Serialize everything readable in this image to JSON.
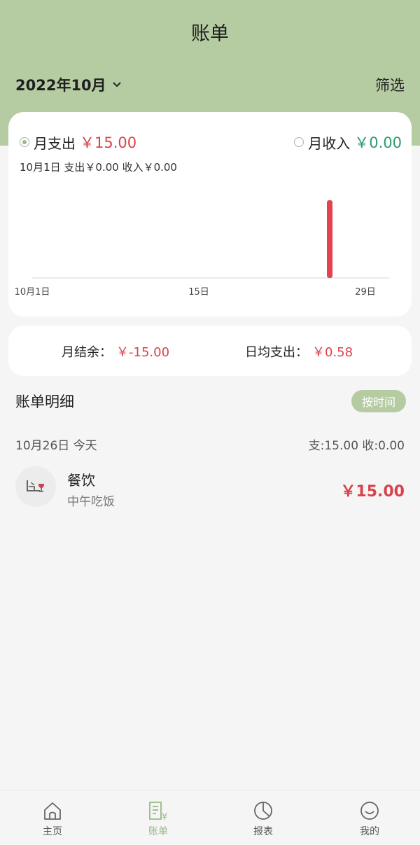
{
  "header": {
    "title": "账单",
    "month": "2022年10月",
    "filter_label": "筛选"
  },
  "chart_card": {
    "expense_label": "月支出",
    "expense_amount": "￥15.00",
    "income_label": "月收入",
    "income_amount": "￥0.00",
    "selected": "expense",
    "day_info": "10月1日  支出￥0.00  收入￥0.00"
  },
  "chart_data": {
    "type": "bar",
    "x_tick_labels": [
      "10月1日",
      "15日",
      "29日"
    ],
    "x": [
      1,
      2,
      3,
      4,
      5,
      6,
      7,
      8,
      9,
      10,
      11,
      12,
      13,
      14,
      15,
      16,
      17,
      18,
      19,
      20,
      21,
      22,
      23,
      24,
      25,
      26,
      27,
      28,
      29,
      30,
      31
    ],
    "values": [
      0,
      0,
      0,
      0,
      0,
      0,
      0,
      0,
      0,
      0,
      0,
      0,
      0,
      0,
      0,
      0,
      0,
      0,
      0,
      0,
      0,
      0,
      0,
      0,
      0,
      15,
      0,
      0,
      0,
      0,
      0
    ],
    "ylim": [
      0,
      15
    ],
    "bar_color": "#e5424f",
    "grid": false
  },
  "summary": {
    "balance_label": "月结余：",
    "balance_value": "￥-15.00",
    "daily_avg_label": "日均支出：",
    "daily_avg_value": "￥0.58"
  },
  "details": {
    "title": "账单明细",
    "sort_label": "按时间",
    "day_header": {
      "date": "10月26日  今天",
      "totals": "支:15.00  收:0.00"
    },
    "items": [
      {
        "icon": "dining-icon",
        "category": "餐饮",
        "note": "中午吃饭",
        "amount": "￥15.00"
      }
    ]
  },
  "tabbar": {
    "tabs": [
      {
        "label": "主页",
        "icon": "home-icon"
      },
      {
        "label": "账单",
        "icon": "bill-icon"
      },
      {
        "label": "报表",
        "icon": "pie-chart-icon"
      },
      {
        "label": "我的",
        "icon": "smiley-icon"
      }
    ],
    "active": "账单"
  },
  "colors": {
    "accent": "#b5cca2",
    "expense": "#d9424b",
    "income": "#2f9a6e"
  }
}
